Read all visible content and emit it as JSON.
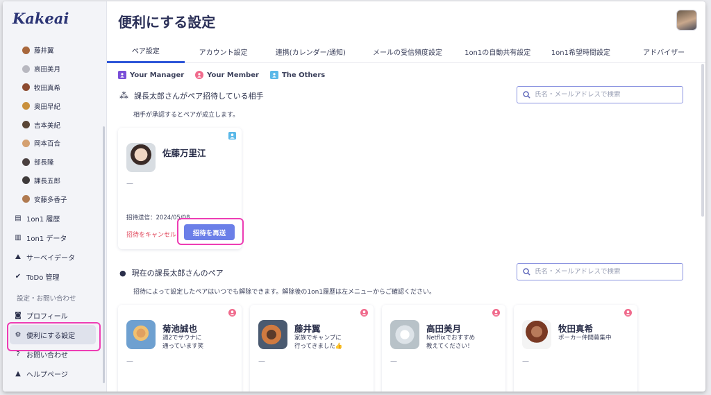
{
  "app": {
    "logo": "Kakeai"
  },
  "sidebar": {
    "members": [
      {
        "name": "藤井翼",
        "color": "#a8673c"
      },
      {
        "name": "高田美月",
        "color": "#b8b8c0"
      },
      {
        "name": "牧田真希",
        "color": "#8c4a30"
      },
      {
        "name": "奥田早紀",
        "color": "#c9903c"
      },
      {
        "name": "吉本美紀",
        "color": "#5a4636"
      },
      {
        "name": "岡本百合",
        "color": "#d4a070"
      },
      {
        "name": "部長隆",
        "color": "#4a4040"
      },
      {
        "name": "課長五郎",
        "color": "#3e3a3a"
      },
      {
        "name": "安藤多香子",
        "color": "#b07a50"
      }
    ],
    "nav": [
      {
        "label": "1on1 履歴",
        "icon": "history-icon",
        "glyph": "▤"
      },
      {
        "label": "1on1 データ",
        "icon": "chart-icon",
        "glyph": "▥"
      },
      {
        "label": "サーベイデータ",
        "icon": "survey-icon",
        "glyph": "⛰"
      },
      {
        "label": "ToDo 管理",
        "icon": "check-circle-icon",
        "glyph": "✔"
      }
    ],
    "settings_section": "設定・お問い合わせ",
    "settings_nav": [
      {
        "label": "プロフィール",
        "icon": "profile-icon",
        "glyph": "◙"
      },
      {
        "label": "便利にする設定",
        "icon": "gear-icon",
        "glyph": "⚙",
        "active": true
      },
      {
        "label": "お問い合わせ",
        "icon": "question-icon",
        "glyph": "?"
      },
      {
        "label": "ヘルプページ",
        "icon": "graduation-cap-icon",
        "glyph": "▲"
      }
    ]
  },
  "page": {
    "title": "便利にする設定"
  },
  "tabs": [
    {
      "label": "ペア設定",
      "active": true,
      "width": 112
    },
    {
      "label": "アカウント設定",
      "width": 112
    },
    {
      "label": "連携(カレンダー/通知)",
      "width": 140
    },
    {
      "label": "メールの受信頻度設定",
      "width": 140
    },
    {
      "label": "1on1の自動共有設定",
      "width": 120
    },
    {
      "label": "1on1希望時間設定",
      "width": 120
    },
    {
      "label": "アドバイザー",
      "width": 120
    }
  ],
  "legend": [
    {
      "label": "Your Manager",
      "color": "#7a4fd8",
      "shape": "square"
    },
    {
      "label": "Your Member",
      "color": "#f06a8c",
      "shape": "round"
    },
    {
      "label": "The Others",
      "color": "#5ab8e8",
      "shape": "square"
    }
  ],
  "pending": {
    "title": "課長太郎さんがペア招待している相手",
    "desc": "相手が承認するとペアが成立します。",
    "search_placeholder": "氏名・メールアドレスで検索",
    "card": {
      "name": "佐藤万里江",
      "message": "—",
      "invite_date": "招待送信：2024/05/08",
      "cancel_label": "招待をキャンセル",
      "resend_label": "招待を再送",
      "badge_color": "#5ab8e8"
    }
  },
  "current": {
    "title": "現在の課長太郎さんのペア",
    "desc": "招待によって設定したペアはいつでも解除できます。解除後の1on1履歴は左メニューからご確認ください。",
    "search_placeholder": "氏名・メールアドレスで検索",
    "cards": [
      {
        "name": "菊池誠也",
        "message": "週2でサウナに\n通っています笑",
        "dash": "—",
        "badge_color": "#f06a8c"
      },
      {
        "name": "藤井翼",
        "message": "家族でキャンプに\n行ってきました👍",
        "dash": "—",
        "badge_color": "#f06a8c"
      },
      {
        "name": "高田美月",
        "message": "Netflixでおすすめ\n教えてください！",
        "dash": "—",
        "badge_color": "#f06a8c"
      },
      {
        "name": "牧田真希",
        "message": "ポーカー仲間募集中",
        "dash": "—",
        "badge_color": "#f06a8c"
      }
    ]
  }
}
